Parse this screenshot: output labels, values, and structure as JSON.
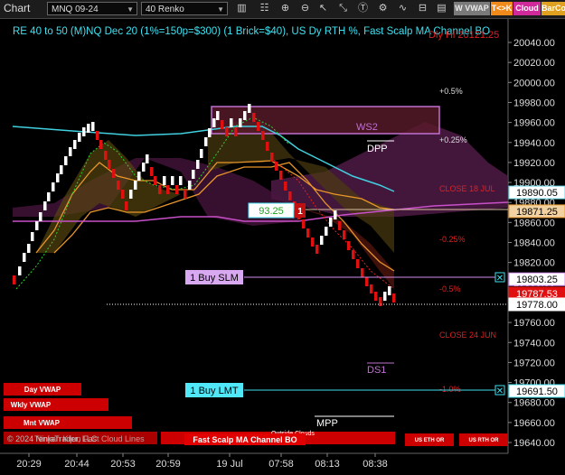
{
  "toolbar": {
    "title": "Chart",
    "instrument": "MNQ 09-24",
    "bar_type": "40 Renko",
    "btn_vwap": "W VWAP",
    "btn_tk": "T<>K",
    "btn_cloud": "Cloud",
    "btn_barco": "BarCo"
  },
  "chart": {
    "header": "RE 40 to 50 (M)NQ Dec 20 (1%=150p=$300) (1 Brick=$40), US Dy RTH %, Fast Scalp MA Channel BO",
    "prior_high": "Dly Hi 20121.25",
    "watermark": "© 2024 NinjaTrader, LLC",
    "legend_text": "Tenkan Kijun Fast Cloud Lines",
    "outside_clouds": "Outside Clouds"
  },
  "price_axis": {
    "ticks": [
      "20040.00",
      "20020.00",
      "20000.00",
      "19980.00",
      "19960.00",
      "19940.00",
      "19920.00",
      "19900.00",
      "19880.00",
      "19860.00",
      "19840.00",
      "19820.00",
      "19800.00",
      "19780.00",
      "19760.00",
      "19740.00",
      "19720.00",
      "19700.00",
      "19680.00",
      "19660.00",
      "19640.00"
    ],
    "flags": [
      {
        "name": "price-flag-close-18jul",
        "text": "19890.05",
        "bg": "#ffffff",
        "fg": "#000000",
        "border": "#6ad6ea"
      },
      {
        "name": "price-flag-orange",
        "text": "19871.25",
        "bg": "#f2d2a0",
        "fg": "#000000",
        "border": "#e89a30"
      },
      {
        "name": "price-flag-buy-slm",
        "text": "19803.25",
        "bg": "#ffffff",
        "fg": "#000000",
        "border": "#d28ef0"
      },
      {
        "name": "price-flag-last",
        "text": "19787.53",
        "bg": "#e01010",
        "fg": "#ffffff",
        "border": "#e01010"
      },
      {
        "name": "price-flag-dotted",
        "text": "19778.00",
        "bg": "#ffffff",
        "fg": "#000000",
        "border": "#ffffff"
      },
      {
        "name": "price-flag-buy-lmt",
        "text": "19691.50",
        "bg": "#ffffff",
        "fg": "#000000",
        "border": "#40e0f0"
      }
    ]
  },
  "time_axis": {
    "ticks": [
      "20:29",
      "20:44",
      "20:53",
      "20:59",
      "19 Jul",
      "07:58",
      "08:13",
      "08:38"
    ]
  },
  "levels": {
    "ws2": "WS2",
    "dpp": "DPP",
    "ds1": "DS1",
    "mpp": "MPP",
    "pct_up_05": "+0.5%",
    "pct_up_025": "+0.25%",
    "close_18jul": "CLOSE 18 JUL",
    "pct_dn_025": "-0.25%",
    "pct_dn_05": "-0.5%",
    "close_24jun": "CLOSE 24 JUN",
    "pct_dn_10": "-1.0%"
  },
  "orders": {
    "buy_slm": "1 Buy SLM",
    "buy_lmt": "1 Buy LMT",
    "stop_value": "93.25",
    "stop_qty": "1"
  },
  "buttons": {
    "day_vwap": "Day VWAP",
    "wkly_vwap": "Wkly VWAP",
    "mnt_vwap": "Mnt VWAP",
    "fast_scalp": "Fast Scalp MA Channel BO",
    "us_eth_or": "US ETH OR",
    "us_rth_or": "US RTH OR"
  },
  "colors": {
    "background": "#000000",
    "brick_up": "#ffffff",
    "brick_down": "#e01010",
    "cyan_ma": "#40d0e0",
    "orange_ma": "#e8962a",
    "magenta_line": "#c850c8",
    "button_red": "#cc0000"
  }
}
